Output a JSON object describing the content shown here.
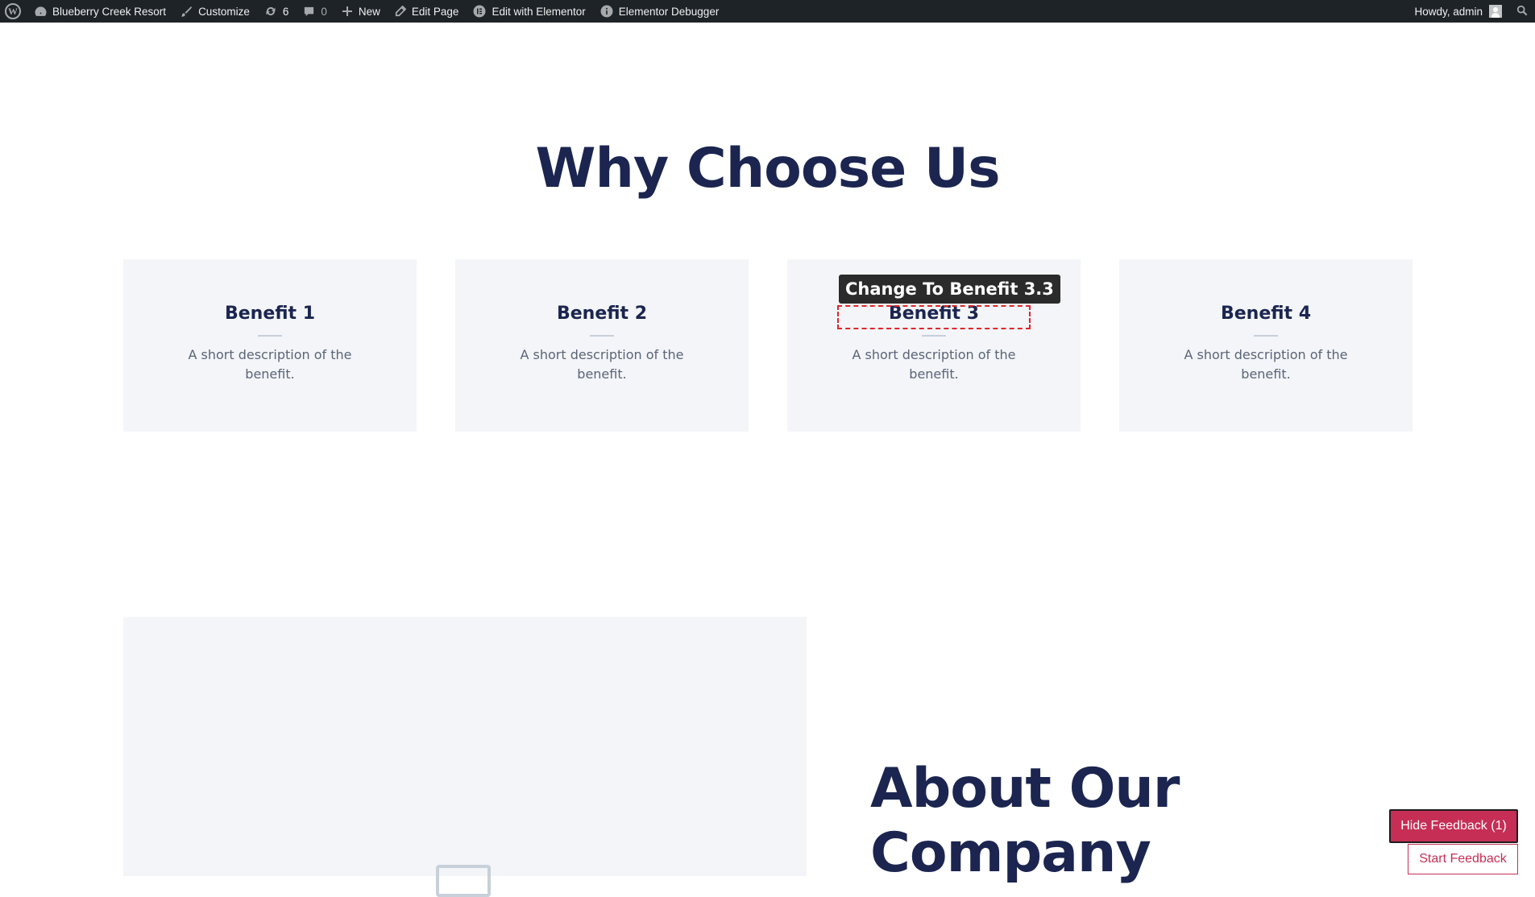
{
  "admin_bar": {
    "site_name": "Blueberry Creek Resort",
    "customize": "Customize",
    "updates_count": "6",
    "comments_count": "0",
    "new": "New",
    "edit_page": "Edit Page",
    "edit_with_elementor": "Edit with Elementor",
    "elementor_debugger": "Elementor Debugger",
    "howdy": "Howdy, admin",
    "icons": [
      "wordpress-logo-icon",
      "dashboard-icon",
      "brush-icon",
      "updates-icon",
      "comment-icon",
      "plus-icon",
      "pencil-icon",
      "elementor-icon",
      "info-icon",
      "search-icon"
    ]
  },
  "why_section": {
    "title": "Why Choose Us",
    "cards": [
      {
        "title": "Benefit 1",
        "description": "A short description of the benefit."
      },
      {
        "title": "Benefit 2",
        "description": "A short description of the benefit."
      },
      {
        "title": "Benefit 3",
        "description": "A short description of the benefit."
      },
      {
        "title": "Benefit 4",
        "description": "A short description of the benefit."
      }
    ],
    "feedback_tooltip": "Change To Benefit 3.3"
  },
  "about_section": {
    "title": "About Our Company"
  },
  "feedback": {
    "hide_label": "Hide Feedback (1)",
    "start_label": "Start Feedback"
  },
  "colors": {
    "heading": "#1b2550",
    "card_bg": "#f3f5f8",
    "admin_bar_bg": "#1d2327",
    "feedback_accent": "#c62e55",
    "highlight_outline": "#e0262b"
  }
}
